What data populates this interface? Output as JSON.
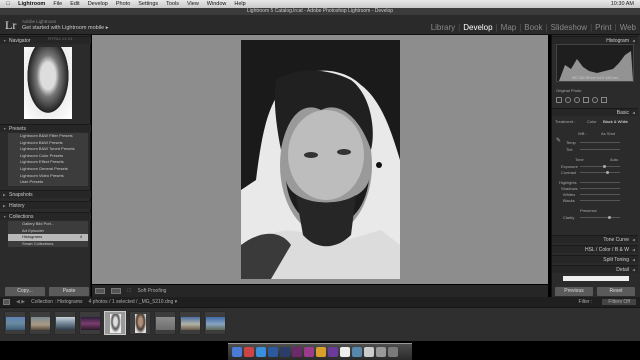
{
  "menubar": {
    "app": "Lightroom",
    "items": [
      "File",
      "Edit",
      "Develop",
      "Photo",
      "Settings",
      "Tools",
      "View",
      "Window",
      "Help"
    ],
    "right": "10:30 AM"
  },
  "window_title": "Lightroom 5 Catalog.lrcat - Adobe Photoshop Lightroom - Develop",
  "identity": {
    "brand_sub": "Adobe Lightroom",
    "plate": "Get started with Lightroom mobile ▸"
  },
  "modules": [
    {
      "label": "Library",
      "active": false
    },
    {
      "label": "Develop",
      "active": true
    },
    {
      "label": "Map",
      "active": false
    },
    {
      "label": "Book",
      "active": false
    },
    {
      "label": "Slideshow",
      "active": false
    },
    {
      "label": "Print",
      "active": false
    },
    {
      "label": "Web",
      "active": false
    }
  ],
  "left": {
    "navigator": "Navigator",
    "navigator_zoom": "FIT  FILL  1:1  3:1",
    "presets_header": "Presets",
    "presets": [
      "Lightroom B&W Filter Presets",
      "Lightroom B&W Presets",
      "Lightroom B&W Toned Presets",
      "Lightroom Color Presets",
      "Lightroom Effect Presets",
      "Lightroom General Presets",
      "Lightroom Video Presets",
      "User Presets"
    ],
    "snapshots": "Snapshots",
    "history": "History",
    "collections_header": "Collections",
    "collections": [
      "Gallery Bild Port...",
      "Art Episoder",
      "Histograms",
      "Smart Collections"
    ],
    "collection_count": "4",
    "copy": "Copy...",
    "paste": "Paste"
  },
  "toolbar": {
    "softproof": "Soft Proofing"
  },
  "right": {
    "histogram": "Histogram",
    "hist_info": "ISO 200   35 mm   f/4.0   1/60 sec",
    "orig": "Original Photo",
    "basic": "Basic",
    "treatment": "Treatment :",
    "color": "Color",
    "bw": "Black & White",
    "wb": "WB :",
    "as_shot": "As Shot",
    "temp": "Temp",
    "tint": "Tint",
    "tone": "Tone",
    "auto": "Auto",
    "exposure": "Exposure",
    "contrast": "Contrast",
    "highlights": "Highlights",
    "shadows": "Shadows",
    "whites": "Whites",
    "blacks": "Blacks",
    "presence": "Presence",
    "clarity": "Clarity",
    "tonecurve": "Tone Curve",
    "hsl": "HSL / Color / B & W",
    "splittoning": "Split Toning",
    "detail": "Detail",
    "previous": "Previous",
    "reset": "Reset"
  },
  "filmstrip": {
    "collection": "Collection : Histograms",
    "count": "4 photos / 1 selected / _MG_5210.dng ▾",
    "filter": "Filter :",
    "filter_value": "Filters Off"
  }
}
